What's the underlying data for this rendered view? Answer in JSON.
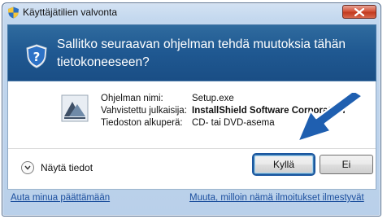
{
  "window": {
    "title": "Käyttäjätilien valvonta",
    "prompt": "Sallitko seuraavan ohjelman tehdä muutoksia tähän tietokoneeseen?"
  },
  "program_info": {
    "rows": [
      {
        "label": "Ohjelman nimi:",
        "value": "Setup.exe",
        "bold": false
      },
      {
        "label": "Vahvistettu julkaisija:",
        "value": "InstallShield Software Corporation",
        "bold": true
      },
      {
        "label": "Tiedoston alkuperä:",
        "value": "CD- tai DVD-asema",
        "bold": false
      }
    ]
  },
  "details": {
    "label": "Näytä tiedot"
  },
  "buttons": {
    "yes": "Kyllä",
    "no": "Ei"
  },
  "links": {
    "help": "Auta minua päättämään",
    "change": "Muuta, milloin nämä ilmoitukset ilmestyvät"
  },
  "colors": {
    "header_band": "#1f5891",
    "link": "#1c4f9e",
    "arrow": "#1f5fb0",
    "close_button": "#c23a1f"
  },
  "icons": [
    "uac-shield-icon",
    "close-icon",
    "program-icon",
    "chevron-down-icon",
    "pointer-arrow"
  ]
}
